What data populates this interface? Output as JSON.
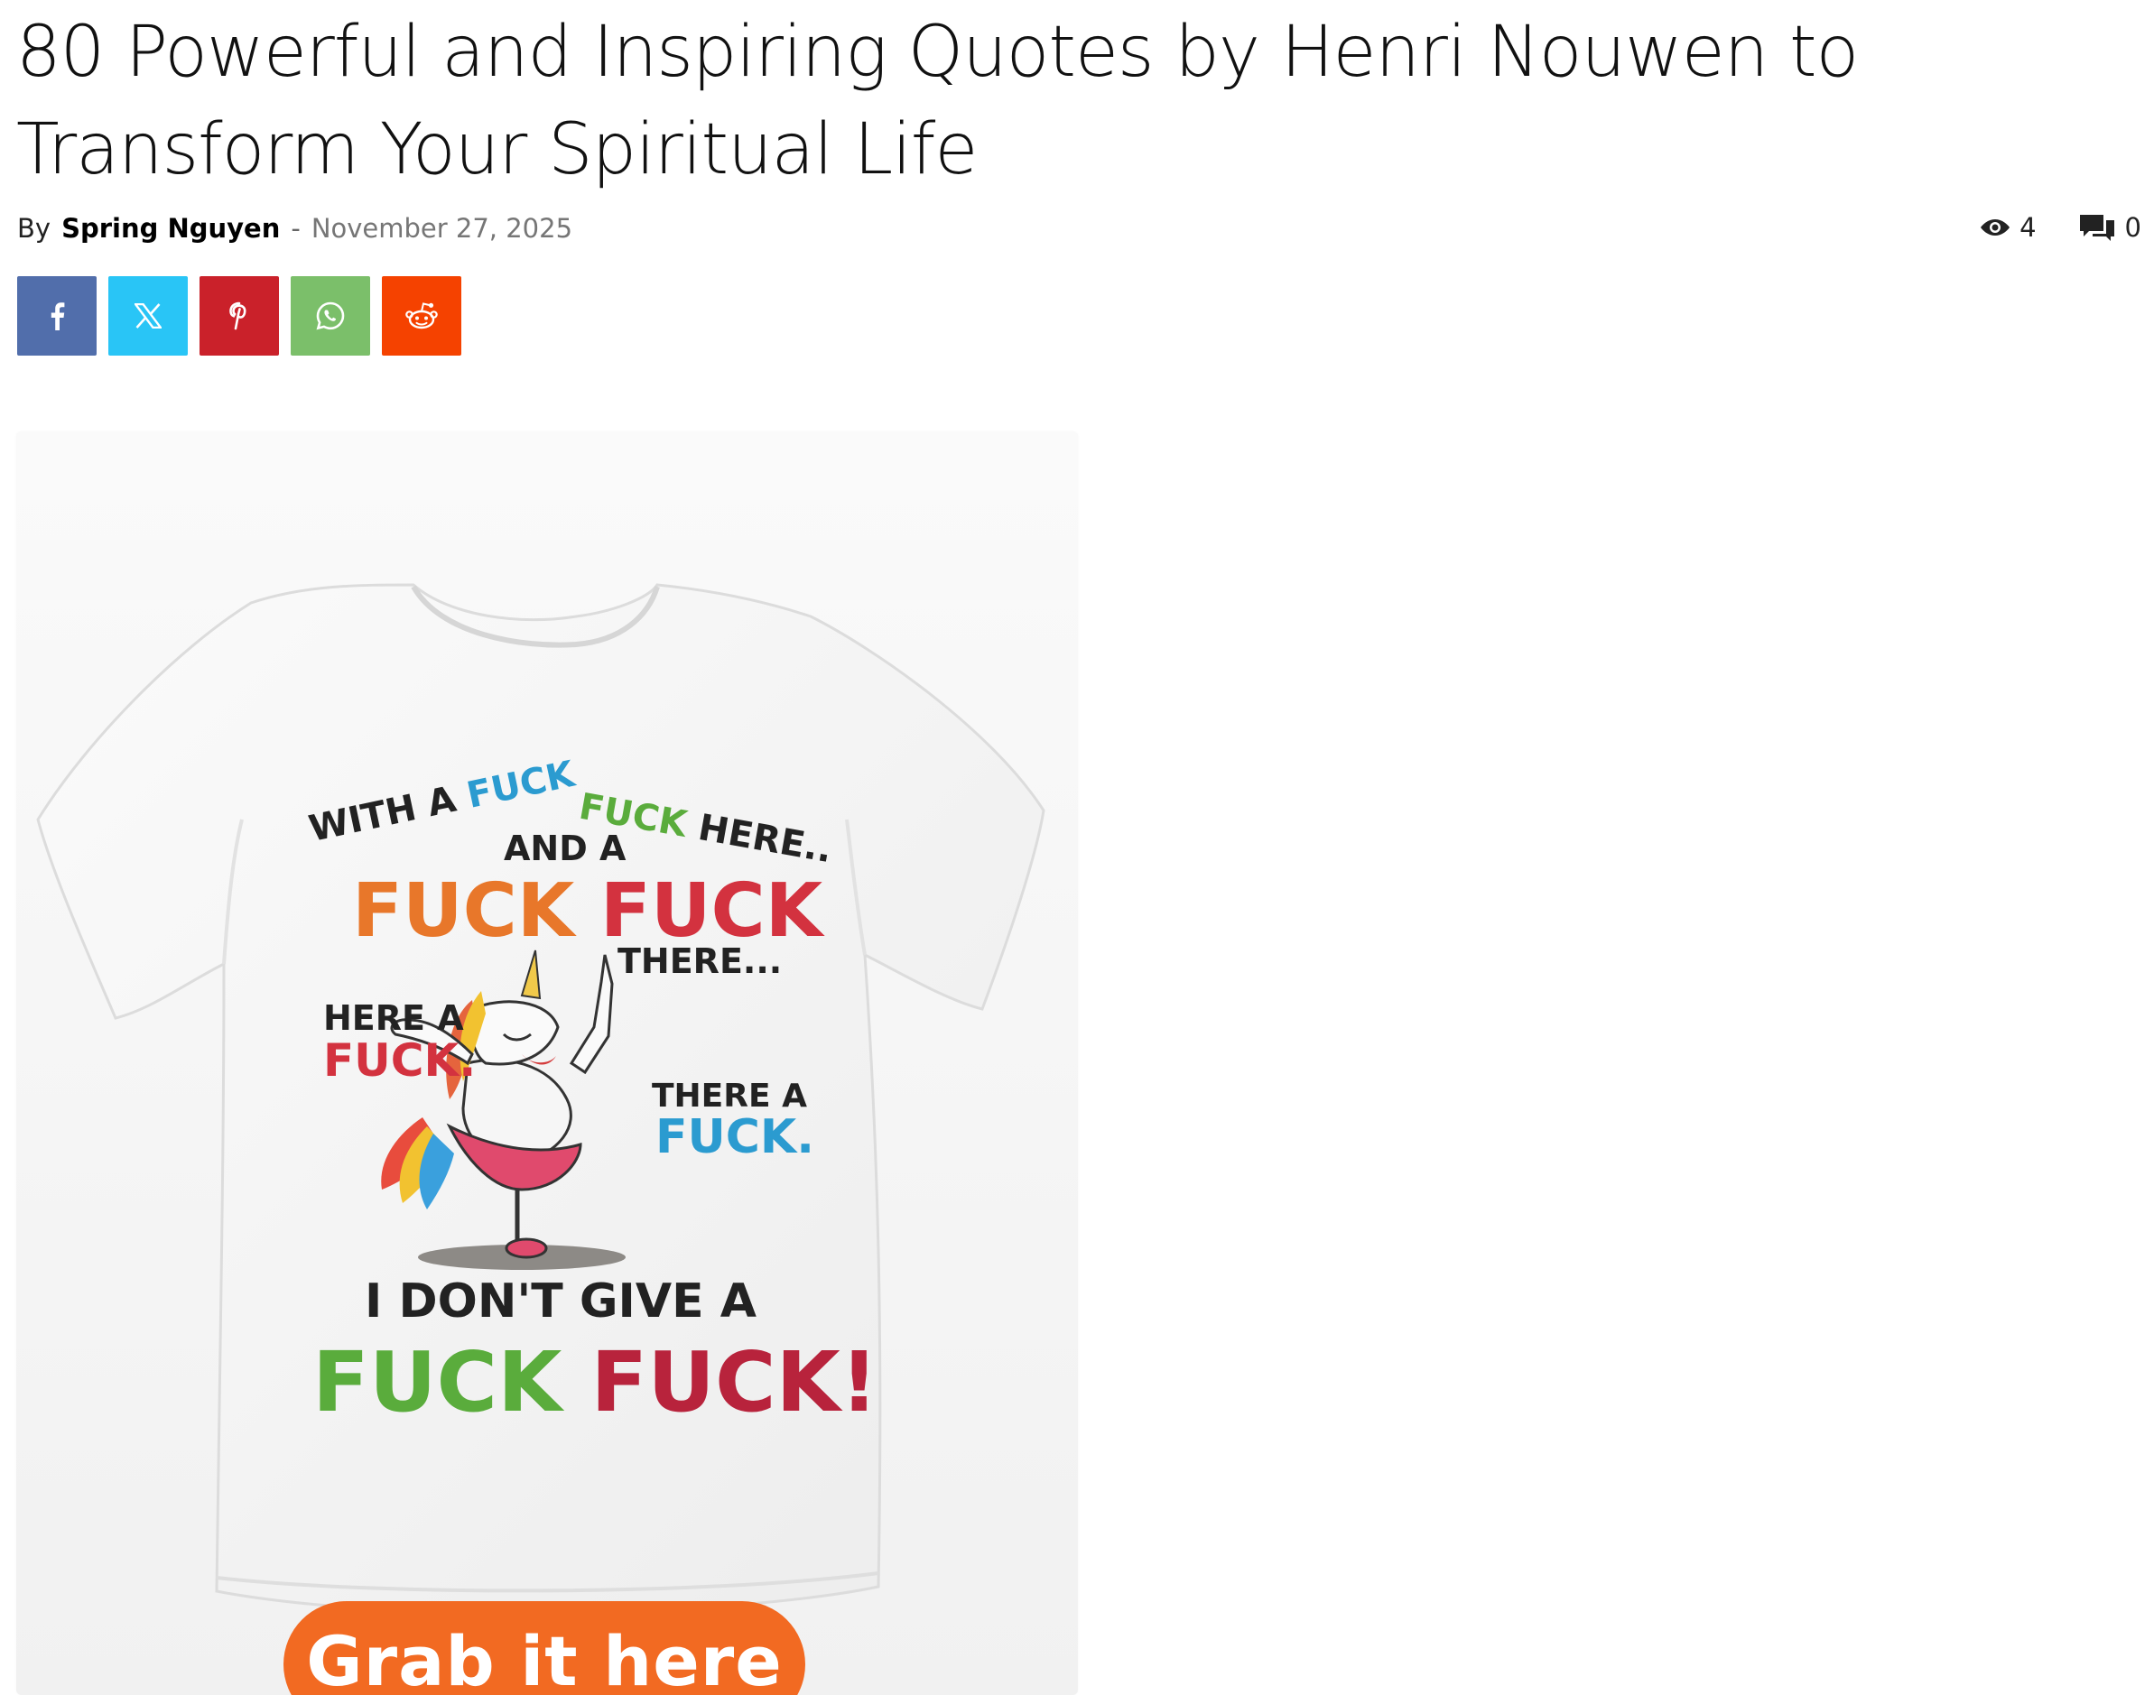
{
  "article": {
    "title": "80 Powerful and Inspiring Quotes by Henri Nouwen to Transform Your Spiritual Life",
    "by_label": "By",
    "author": "Spring Nguyen",
    "separator": "-",
    "date": "November 27, 2025",
    "views": "4",
    "comments": "0"
  },
  "share": {
    "buttons": [
      {
        "name": "facebook",
        "icon": "facebook-icon",
        "color": "#516eab"
      },
      {
        "name": "x",
        "icon": "x-icon",
        "color": "#29c5f6"
      },
      {
        "name": "pinterest",
        "icon": "pinterest-icon",
        "color": "#ca212a"
      },
      {
        "name": "whatsapp",
        "icon": "whatsapp-icon",
        "color": "#7bbf6a"
      },
      {
        "name": "reddit",
        "icon": "reddit-icon",
        "color": "#f54200"
      }
    ]
  },
  "ad": {
    "shirt_lines": {
      "line1_a": "WITH A",
      "line1_b": "FUCK",
      "line1_c": "FUCK",
      "line1_d": "HERE..",
      "line2": "AND A",
      "line3_a": "FUCK",
      "line3_b": "FUCK",
      "line4": "THERE...",
      "line5_a": "HERE A",
      "line5_b": "FUCK.",
      "line6_a": "THERE A",
      "line6_b": "FUCK.",
      "line7": "I DON'T GIVE A",
      "line8_a": "FUCK",
      "line8_b": "FUCK!"
    },
    "cta": "Grab it here"
  },
  "colors": {
    "orange": "#e8772a",
    "red": "#d3323f",
    "blue": "#2b9bd0",
    "green": "#5aac3c",
    "crimson": "#b8233c",
    "cta": "#f26a22"
  }
}
